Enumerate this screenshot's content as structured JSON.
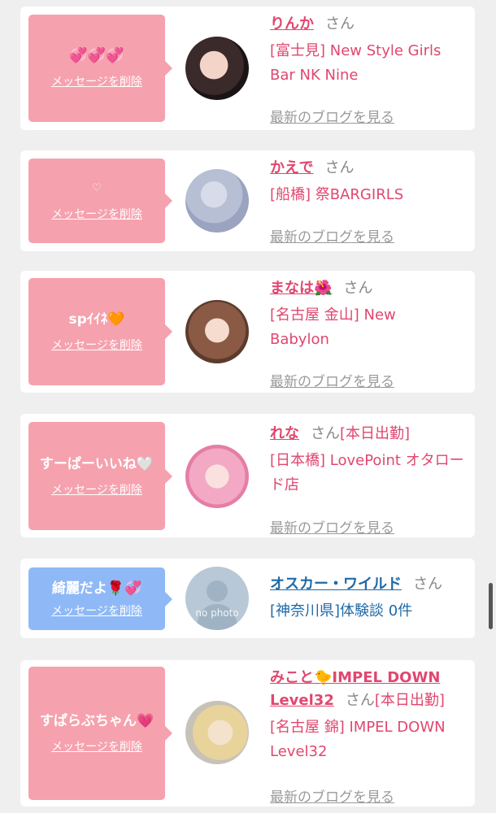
{
  "cards": [
    {
      "message": "💞💞💞",
      "delete_label": "メッセージを削除",
      "name": "りんか",
      "honorific": "さん",
      "tag": "",
      "shop": "[富士見] New Style Girls Bar NK Nine",
      "blog_label": "最新のブログを見る",
      "theme": "pink"
    },
    {
      "message": "♡",
      "delete_label": "メッセージを削除",
      "name": "かえで",
      "honorific": "さん",
      "tag": "",
      "shop": "[船橋] 祭BARGIRLS",
      "blog_label": "最新のブログを見る",
      "theme": "pink"
    },
    {
      "message": "spｲｲﾈ🧡",
      "delete_label": "メッセージを削除",
      "name": "まなは🌺",
      "honorific": "さん",
      "tag": "",
      "shop": "[名古屋 金山] New Babylon",
      "blog_label": "最新のブログを見る",
      "theme": "pink"
    },
    {
      "message": "すーぱーいいね🤍",
      "delete_label": "メッセージを削除",
      "name": "れな",
      "honorific": "さん",
      "tag": "[本日出勤]",
      "shop": "[日本橋] LovePoint オタロード店",
      "blog_label": "最新のブログを見る",
      "theme": "pink"
    },
    {
      "message": "綺麗だよ🌹💞",
      "delete_label": "メッセージを削除",
      "name": "オスカー・ワイルド",
      "honorific": "さん",
      "tag": "",
      "shop": "[神奈川県]体験談 0件",
      "blog_label": "",
      "avatar_text": "no photo",
      "theme": "blue"
    },
    {
      "message": "すぱらぶちゃん💗",
      "delete_label": "メッセージを削除",
      "name": "みこと🐤IMPEL DOWN Level32",
      "honorific": "さん",
      "tag": "[本日出勤]",
      "shop": "[名古屋 錦] IMPEL DOWN Level32",
      "blog_label": "最新のブログを見る",
      "theme": "pink"
    }
  ],
  "colors": {
    "pink_bubble": "#f6a1ae",
    "blue_bubble": "#8fb9f6",
    "name_pink": "#e0476f",
    "name_blue": "#1e6aa8",
    "muted": "#9a9a9a"
  }
}
